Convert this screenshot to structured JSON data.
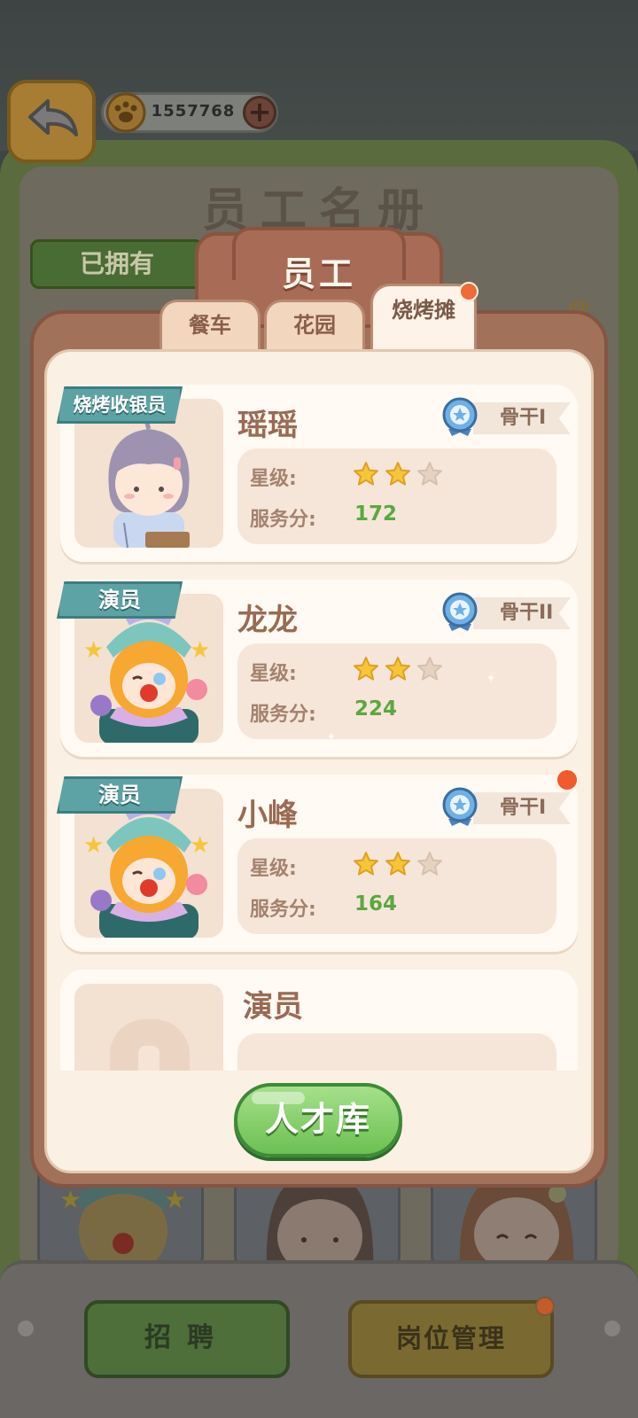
{
  "header": {
    "currency_amount": "1557768",
    "add_label": "+"
  },
  "background": {
    "title": "员工名册",
    "owned_tab": "已拥有"
  },
  "modal": {
    "title": "员工",
    "tabs": [
      {
        "label": "餐车",
        "active": false
      },
      {
        "label": "花园",
        "active": false
      },
      {
        "label": "烧烤摊",
        "active": true,
        "badge": true
      }
    ],
    "employees": [
      {
        "role": "烧烤收银员",
        "name": "瑶瑶",
        "rank": "骨干I",
        "star_label": "星级:",
        "stars": 2,
        "max_stars": 3,
        "score_label": "服务分:",
        "score": "172",
        "avatar": "girl-cashier"
      },
      {
        "role": "演员",
        "name": "龙龙",
        "rank": "骨干II",
        "star_label": "星级:",
        "stars": 2,
        "max_stars": 3,
        "score_label": "服务分:",
        "score": "224",
        "avatar": "clown"
      },
      {
        "role": "演员",
        "name": "小峰",
        "rank": "骨干I",
        "star_label": "星级:",
        "stars": 2,
        "max_stars": 3,
        "score_label": "服务分:",
        "score": "164",
        "avatar": "clown",
        "badge": true
      }
    ],
    "empty_slot": {
      "role_name": "演员"
    },
    "talent_button": "人才库"
  },
  "footer": {
    "recruit": "招聘",
    "post_manage": "岗位管理"
  },
  "colors": {
    "accent_green": "#6cc052",
    "score_green": "#5aa840",
    "modal_brown": "#a2715a",
    "banner_teal": "#5da3a5",
    "badge_red": "#f05a2c",
    "star_gold": "#f5c63a"
  }
}
